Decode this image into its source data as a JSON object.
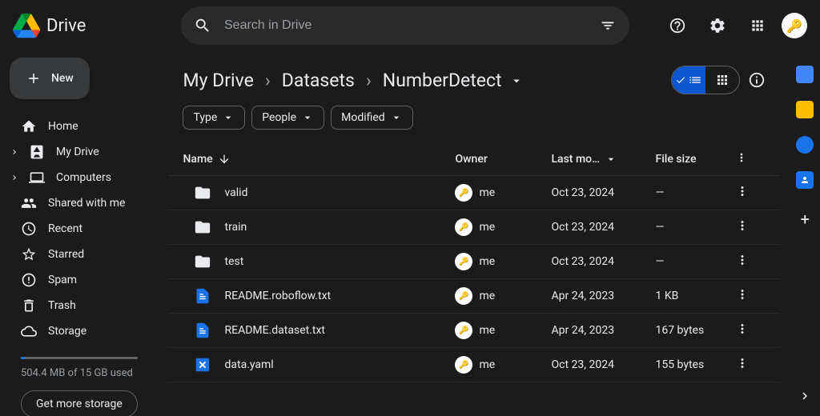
{
  "header": {
    "app_name": "Drive",
    "search_placeholder": "Search in Drive"
  },
  "sidebar": {
    "new_label": "New",
    "nav1": [
      {
        "label": "Home"
      },
      {
        "label": "My Drive"
      },
      {
        "label": "Computers"
      }
    ],
    "nav2": [
      {
        "label": "Shared with me"
      },
      {
        "label": "Recent"
      },
      {
        "label": "Starred"
      }
    ],
    "nav3": [
      {
        "label": "Spam"
      },
      {
        "label": "Trash"
      },
      {
        "label": "Storage"
      }
    ],
    "storage_text": "504.4 MB of 15 GB used",
    "get_storage": "Get more storage"
  },
  "breadcrumb": {
    "items": [
      {
        "label": "My Drive"
      },
      {
        "label": "Datasets"
      },
      {
        "label": "NumberDetect"
      }
    ]
  },
  "chips": {
    "type": "Type",
    "people": "People",
    "modified": "Modified"
  },
  "table": {
    "cols": {
      "name": "Name",
      "owner": "Owner",
      "modified": "Last mo…",
      "size": "File size"
    },
    "rows": [
      {
        "icon": "folder",
        "name": "valid",
        "owner": "me",
        "modified": "Oct 23, 2024",
        "size": "—"
      },
      {
        "icon": "folder",
        "name": "train",
        "owner": "me",
        "modified": "Oct 23, 2024",
        "size": "—"
      },
      {
        "icon": "folder",
        "name": "test",
        "owner": "me",
        "modified": "Oct 23, 2024",
        "size": "—"
      },
      {
        "icon": "doc",
        "name": "README.roboflow.txt",
        "owner": "me",
        "modified": "Apr 24, 2023",
        "size": "1 KB"
      },
      {
        "icon": "doc",
        "name": "README.dataset.txt",
        "owner": "me",
        "modified": "Apr 24, 2023",
        "size": "167 bytes"
      },
      {
        "icon": "yaml",
        "name": "data.yaml",
        "owner": "me",
        "modified": "Oct 23, 2024",
        "size": "155 bytes"
      }
    ]
  }
}
